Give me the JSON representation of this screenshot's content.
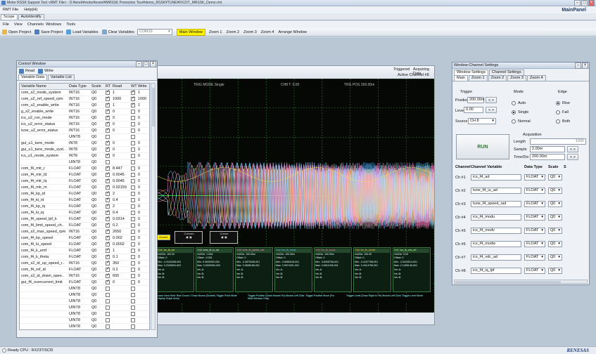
{
  "titlebar": {
    "text": "Motor RSSK Support Tool  <RMT File> : D:¥work¥motor¥event¥MRSSK Promotion Tour¥demo_RSSK¥TUNE¥RX23T_MRSSK_Demo.rmt"
  },
  "menu": {
    "items": [
      "RMT File",
      "Help(H)"
    ],
    "panel_title": "MainPanel"
  },
  "scope_tabs": [
    "Scope",
    "AutoIdentify"
  ],
  "scope_menu": [
    "File",
    "View",
    "Channels",
    "Windows",
    "Tools"
  ],
  "toolbar": {
    "open": "Open Project",
    "save": "Save Project",
    "load": "Load Variables",
    "clear": "Clear Variables",
    "com": "COM19",
    "main_window": "Main Window",
    "zooms": [
      "Zoom 1",
      "Zoom 2",
      "Zoom 3",
      "Zoom 4"
    ],
    "arrange": "Arrange Window"
  },
  "scope": {
    "status1": "Triggered",
    "status2": "Acquiring Data",
    "active_ch": "Active Channel #8",
    "prev": "Prev",
    "trig_mode": "TRIG MODE Single",
    "ch8": "CH8  T: 0.00",
    "trig_pos": "TRG POS 200.00m",
    "cursor1": "Cursors",
    "cursor2": "Cursor",
    "legend": "Zoom4",
    "info": [
      {
        "h": "Ch1: ics_fk_ad",
        "l": [
          "Vol/Div: 100.00",
          "Offset: 0",
          "Min: -4.3154258-003",
          "Max: 3.2325693-003",
          "Ver-A:",
          "Ver-B:",
          "Ver-B:"
        ]
      },
      {
        "h": "Ch2: tune_fk_iu_ad",
        "l": [
          "Vol/Div: 1.00m",
          "Offset: -0.001",
          "Min: 0.0000000-000",
          "Max: 0.0000000-000",
          "Ver-A:",
          "Ver-B:",
          "Ver-B:"
        ]
      },
      {
        "h": "Ch3: tune_fk_speed_rad",
        "l": [
          "Vol/Div: 100.00m",
          "Offset: 0",
          "Min: -3.0875408-001",
          "Max: 3.0656158-001",
          "Ver-A:",
          "Ver-B:",
          "Ver-B:"
        ]
      },
      {
        "h": "Ch4: ics_fk_modu",
        "l": [
          "Vol/Div: 100.00m",
          "Offset: 0",
          "Min: -3.8980018-001",
          "Max: 3.9974291-001",
          "Ver-A:",
          "Ver-B:",
          "Ver-B:"
        ]
      },
      {
        "h": "Ch5: ics_fk_modv",
        "l": [
          "Vol/Div: 100.00m",
          "Offset: 0",
          "Min: -3.6005708-001",
          "Max: 3.6511208-001",
          "Ver-A:",
          "Ver-B:",
          "Ver-B:"
        ]
      },
      {
        "h": "Ch6: ics_fk_modw",
        "l": [
          "Vol/Div: 100.00",
          "Offset: 0",
          "Min: -3.4157758-001",
          "Max: 3.4314798-001",
          "Ver-A:",
          "Ver-B:",
          "Ver-B:"
        ]
      },
      {
        "h": "Ch7: ics_fk_vdc_ad",
        "l": [
          "Vol/Div: 5.00",
          "Offset: 0",
          "Min: -2.5433514-001",
          "Max: 2.1455148-001",
          "Ver-A:",
          "Ver-B:",
          "Ver-B:"
        ]
      }
    ],
    "hint1": "Cursor Area Hold: Rise Cursor / Draw Mouse (Double) Trigger Point Mode (Display Graph Area)",
    "hint2": "Trigger Position (Draw Mouse-Fix) Mouse-Left Click: Trigger Position Move (For Main Window Only)",
    "hint3": "Trigger Level (Draw Right to Fix) Mouse-Left Click: Trigger Level Move"
  },
  "control": {
    "title": "Control Window",
    "read": "Read",
    "write": "Write",
    "tabs": [
      "Variable Data",
      "Variable List"
    ],
    "headers": [
      "Variable Name",
      "Data Type",
      "Scale",
      "RT",
      "Read",
      "WT",
      "Write"
    ],
    "rows": [
      [
        "com_s2_mode_system",
        "INT16",
        "Q0",
        "1",
        "1"
      ],
      [
        "com_u2_ref_speed_rpm",
        "INT16",
        "Q0",
        "1000",
        "1000"
      ],
      [
        "com_u2_enable_write",
        "INT16",
        "Q0",
        "1",
        "1"
      ],
      [
        "g_s2_enable_write",
        "INT16",
        "Q0",
        "0",
        "0"
      ],
      [
        "ics_u2_run_mode",
        "INT16",
        "Q0",
        "0",
        "0"
      ],
      [
        "ics_u2_error_status",
        "INT16",
        "Q0",
        "0",
        "0"
      ],
      [
        "tune_u2_error_status",
        "INT16",
        "Q0",
        "0",
        "0"
      ],
      [
        "",
        "UINT8",
        "Q0",
        "",
        ""
      ],
      [
        "gui_u1_tune_mode",
        "INT8",
        "Q0",
        "0",
        "0"
      ],
      [
        "gui_u1_tune_mode_syst..",
        "INT8",
        "Q0",
        "0",
        "0"
      ],
      [
        "ics_u1_mode_system",
        "INT8",
        "Q0",
        "0",
        "0"
      ],
      [
        "",
        "UINT8",
        "Q0",
        "",
        ""
      ],
      [
        "com_f4_mtr_r",
        "FLOAT",
        "Q0",
        "8.447",
        "0"
      ],
      [
        "com_f4_mtr_ld",
        "FLOAT",
        "Q0",
        "0.0045",
        "0"
      ],
      [
        "com_f4_mtr_lq",
        "FLOAT",
        "Q0",
        "0.0045",
        "0"
      ],
      [
        "com_f4_mtr_m",
        "FLOAT",
        "Q0",
        "0.02159",
        "0"
      ],
      [
        "com_f4_kp_id",
        "FLOAT",
        "Q0",
        "2",
        "0"
      ],
      [
        "com_f4_ki_id",
        "FLOAT",
        "Q0",
        "0.4",
        "0"
      ],
      [
        "com_f4_kp_iq",
        "FLOAT",
        "Q0",
        "2",
        "0"
      ],
      [
        "com_f4_ki_iq",
        "FLOAT",
        "Q0",
        "0.4",
        "0"
      ],
      [
        "com_f4_speed_lpf_k",
        "FLOAT",
        "Q0",
        "0.0314",
        "0"
      ],
      [
        "com_f4_limit_speed_ch..",
        "FLOAT",
        "Q0",
        "0.2",
        "0"
      ],
      [
        "com_s2_max_speed_rpm",
        "INT16",
        "Q0",
        "2650",
        "0"
      ],
      [
        "com_f4_kp_speed",
        "FLOAT",
        "Q0",
        "0.002",
        "0"
      ],
      [
        "com_f4_ki_speed",
        "FLOAT",
        "Q0",
        "0.0002",
        "0"
      ],
      [
        "com_f4_k_emf",
        "FLOAT",
        "Q0",
        "1",
        "0"
      ],
      [
        "com_f4_k_theta",
        "FLOAT",
        "Q0",
        "0.1",
        "0"
      ],
      [
        "com_s2_id_up_speed_r..",
        "INT16",
        "Q0",
        "350",
        "0"
      ],
      [
        "com_f4_ref_id",
        "FLOAT",
        "Q0",
        "0.2",
        "0"
      ],
      [
        "com_s2_id_down_spee..",
        "INT16",
        "Q0",
        "600",
        "0"
      ],
      [
        "gui_f4_overcurrent_limit",
        "FLOAT",
        "Q0",
        "0",
        "0"
      ],
      [
        "",
        "UINT8",
        "Q0",
        "",
        ""
      ],
      [
        "",
        "UINT8",
        "Q0",
        "",
        ""
      ],
      [
        "",
        "UINT8",
        "Q0",
        "",
        ""
      ],
      [
        "",
        "UINT8",
        "Q0",
        "",
        ""
      ],
      [
        "",
        "UINT8",
        "Q0",
        "",
        ""
      ],
      [
        "",
        "UINT8",
        "Q0",
        "",
        ""
      ],
      [
        "",
        "UINT8",
        "Q0",
        "",
        ""
      ]
    ]
  },
  "wcs": {
    "title": "Window-Channel Settings",
    "tabs": [
      "Window Settings",
      "Channel Settings"
    ],
    "subtabs": [
      "Main",
      "Zoom 1",
      "Zoom 2",
      "Zoom 3",
      "Zoom 4"
    ],
    "trigger": "Trigger",
    "position_lbl": "Position",
    "position_val": "200.00m",
    "level_lbl": "Level",
    "level_val": "0.00",
    "source_lbl": "Source",
    "source_val": "CH 8",
    "mode": "Mode",
    "mode_opts": [
      "Auto",
      "Single",
      "Normal"
    ],
    "edge": "Edge",
    "edge_opts": [
      "Rise",
      "Fall",
      "Both"
    ],
    "acq": "Acquisition",
    "length_lbl": "Length",
    "length_val": "1000",
    "sample_lbl": "Sample",
    "sample_val": "2.00m",
    "tdiv_lbl": "Time/Div",
    "tdiv_val": "200.00m",
    "run": "RUN",
    "ch_headers": [
      "Channel",
      "Channel Variable",
      "Data Type",
      "Scale",
      "S"
    ],
    "channels": [
      [
        "Ch #1",
        "ics_f4_ad",
        "FLOAT",
        "Q0"
      ],
      [
        "Ch #2",
        "tune_f4_iu_ad",
        "FLOAT",
        "Q0"
      ],
      [
        "Ch #3",
        "tune_f4_speed_rad",
        "FLOAT",
        "Q0"
      ],
      [
        "Ch #4",
        "ics_f4_modu",
        "FLOAT",
        "Q0"
      ],
      [
        "Ch #5",
        "ics_f4_modv",
        "FLOAT",
        "Q0"
      ],
      [
        "Ch #6",
        "ics_f4_modw",
        "FLOAT",
        "Q0"
      ],
      [
        "Ch #7",
        "ics_f4_vdc_ad",
        "FLOAT",
        "Q0"
      ],
      [
        "Ch #8",
        "ics_f4_iq_lpf",
        "FLOAT",
        "Q0"
      ]
    ]
  },
  "statusbar": {
    "text": "Ready  CPU : RX23T/SCI5",
    "brand": "RENESAS"
  },
  "colors": {
    "ch1": "#ffe24a",
    "ch2": "#e6e6e6",
    "ch3": "#ff8cd2",
    "ch4": "#58c6ff",
    "ch5": "#ff6ab0",
    "ch6": "#ffb347",
    "ch7": "#c0ff90",
    "ch8": "#c7e9ff",
    "grid": "#2f7f32",
    "trig": "#37ff4c"
  }
}
